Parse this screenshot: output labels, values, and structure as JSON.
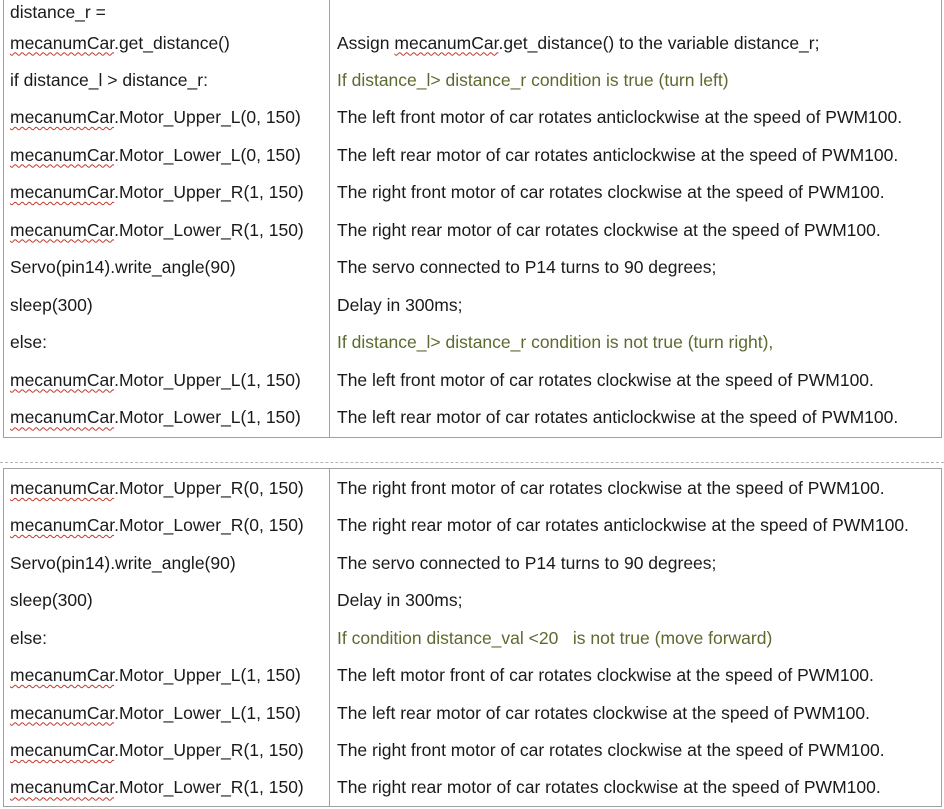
{
  "table1": {
    "rows": [
      {
        "code": {
          "text": "distance_r =",
          "squiggle": false
        },
        "desc": {
          "text": "",
          "comment": false
        }
      },
      {
        "code": {
          "prefix": "mecanumCar",
          "rest": ".get_distance()"
        },
        "desc": {
          "before": "Assign ",
          "squiggle": "mecanumCar",
          "after": ".get_distance() to the variable distance_r;"
        }
      },
      {
        "code": {
          "text": "if distance_l > distance_r:"
        },
        "desc": {
          "text": "If distance_l> distance_r condition is true (turn left)"
        }
      },
      {
        "code": {
          "prefix": "mecanumCar",
          "rest": ".Motor_Upper_L(0, 150)"
        },
        "desc": {
          "text": "The left front motor of car rotates anticlockwise at the speed of PWM100."
        }
      },
      {
        "code": {
          "prefix": "mecanumCar",
          "rest": ".Motor_Lower_L(0, 150)"
        },
        "desc": {
          "text": "The left rear motor of car rotates anticlockwise at the speed of PWM100."
        }
      },
      {
        "code": {
          "prefix": "mecanumCar",
          "rest": ".Motor_Upper_R(1, 150)"
        },
        "desc": {
          "text": "The right front motor of car rotates clockwise at the speed of PWM100."
        }
      },
      {
        "code": {
          "prefix": "mecanumCar",
          "rest": ".Motor_Lower_R(1, 150)"
        },
        "desc": {
          "text": "The right rear motor of car rotates clockwise at the speed of PWM100."
        }
      },
      {
        "code": {
          "text": "Servo(pin14).write_angle(90)"
        },
        "desc": {
          "text": "The servo connected to P14 turns to 90 degrees;"
        }
      },
      {
        "code": {
          "text": "sleep(300)"
        },
        "desc": {
          "text": "Delay in 300ms;"
        }
      },
      {
        "code": {
          "text": "else:"
        },
        "desc": {
          "text": "If distance_l> distance_r condition is not true (turn right),"
        }
      },
      {
        "code": {
          "prefix": "mecanumCar",
          "rest": ".Motor_Upper_L(1, 150)"
        },
        "desc": {
          "text": "The left front motor of car rotates clockwise at the speed of PWM100."
        }
      },
      {
        "code": {
          "prefix": "mecanumCar",
          "rest": ".Motor_Lower_L(1, 150)"
        },
        "desc": {
          "text": "The left rear motor of car rotates anticlockwise at the speed of PWM100."
        }
      }
    ]
  },
  "page_break_mark": "...",
  "table2": {
    "rows": [
      {
        "code": {
          "prefix": "mecanumCar",
          "rest": ".Motor_Upper_R(0, 150)"
        },
        "desc": {
          "text": "The right front motor of car rotates clockwise at the speed of PWM100."
        }
      },
      {
        "code": {
          "prefix": "mecanumCar",
          "rest": ".Motor_Lower_R(0, 150)"
        },
        "desc": {
          "text": "The right rear motor of car rotates anticlockwise at the speed of PWM100."
        }
      },
      {
        "code": {
          "text": "Servo(pin14).write_angle(90)"
        },
        "desc": {
          "text": "The servo connected to P14 turns to 90 degrees;"
        }
      },
      {
        "code": {
          "text": "sleep(300)"
        },
        "desc": {
          "text": "Delay in 300ms;"
        }
      },
      {
        "code": {
          "text": "else:"
        },
        "desc": {
          "text": "If condition distance_val <20   is not true (move forward)"
        }
      },
      {
        "code": {
          "prefix": "mecanumCar",
          "rest": ".Motor_Upper_L(1, 150)"
        },
        "desc": {
          "text": "The left motor front of car rotates clockwise at the speed of PWM100."
        }
      },
      {
        "code": {
          "prefix": "mecanumCar",
          "rest": ".Motor_Lower_L(1, 150)"
        },
        "desc": {
          "text": "The left rear motor of car rotates clockwise at the speed of PWM100."
        }
      },
      {
        "code": {
          "prefix": "mecanumCar",
          "rest": ".Motor_Upper_R(1, 150)"
        },
        "desc": {
          "text": "The right front motor of car rotates clockwise at the speed of PWM100."
        }
      },
      {
        "code": {
          "prefix": "mecanumCar",
          "rest": ".Motor_Lower_R(1, 150)"
        },
        "desc": {
          "text": "The right rear motor of car rotates clockwise at the speed of PWM100."
        }
      }
    ]
  },
  "colors": {
    "text": "#1a1a1a",
    "comment_text": "#5b6a2e",
    "spellcheck_squiggle": "#c0392b",
    "border": "#a0a0a0"
  }
}
